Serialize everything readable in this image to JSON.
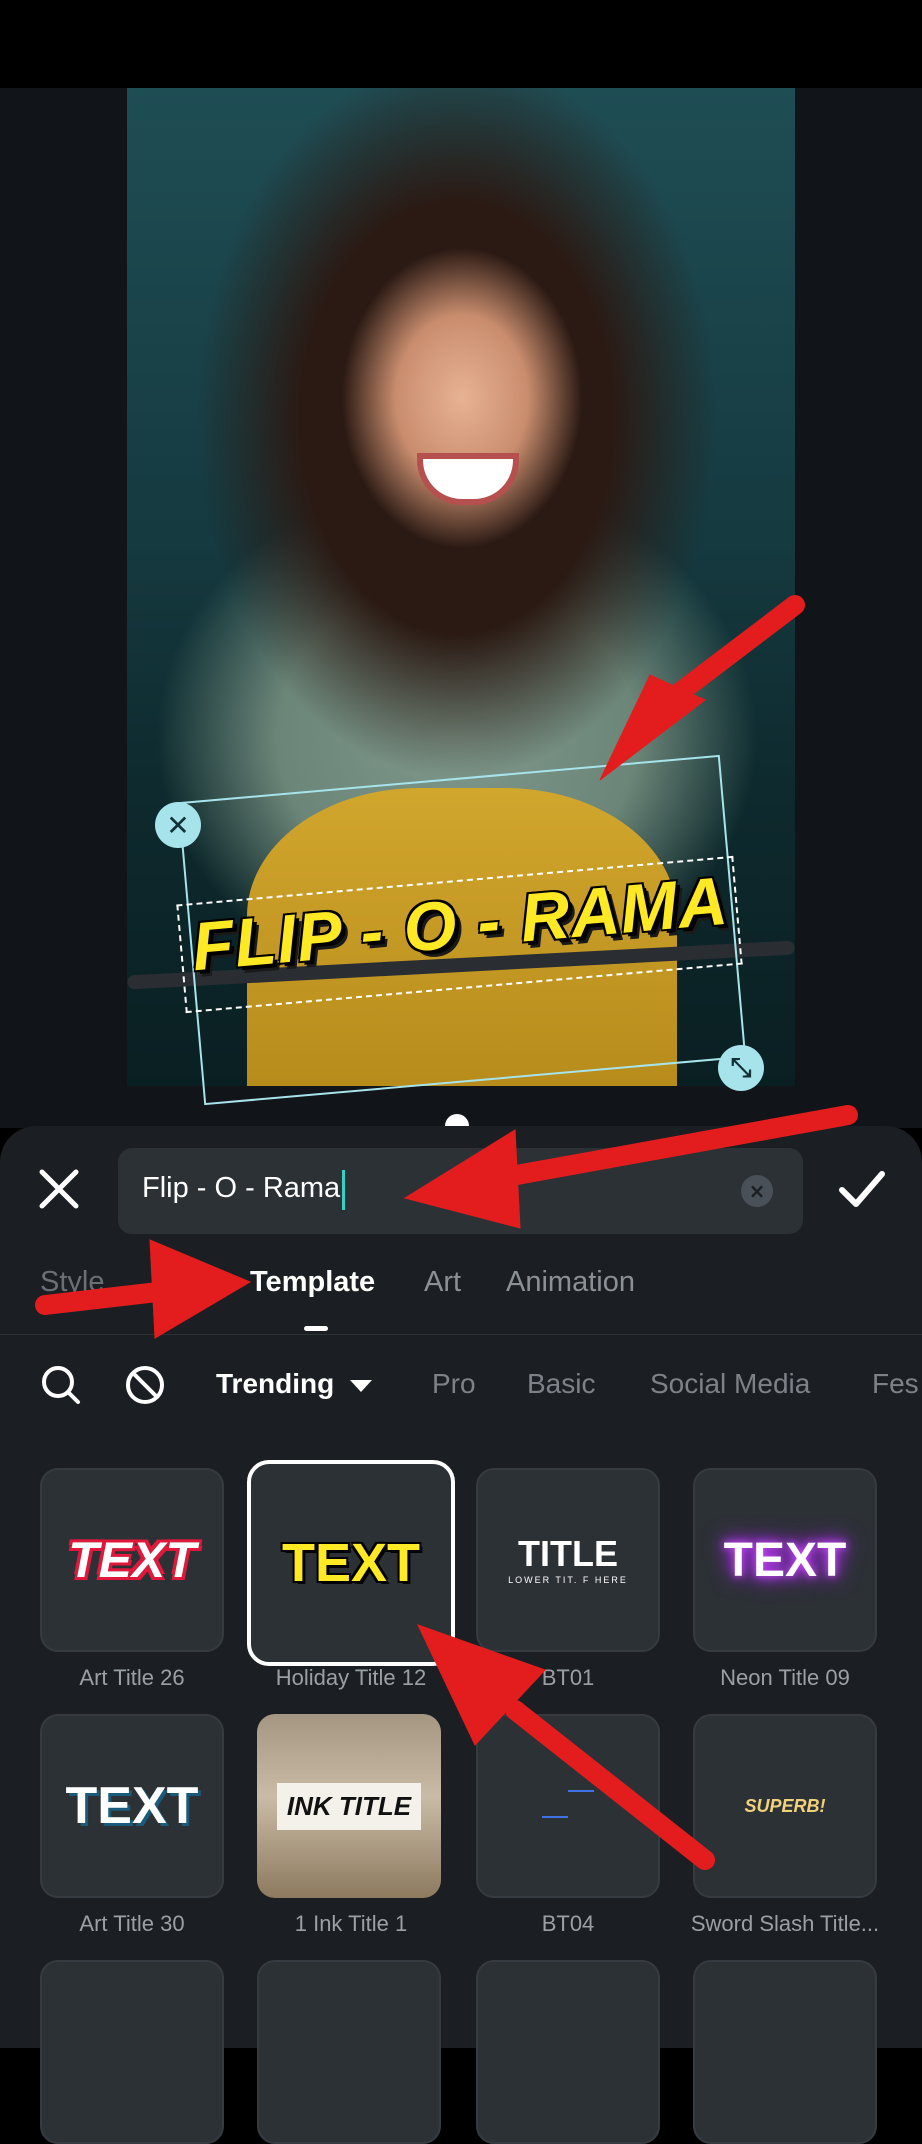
{
  "editor": {
    "overlay_title": "FLIP - O - RAMA",
    "text_input_value": "Flip - O - Rama"
  },
  "tabs": [
    {
      "label": "Style"
    },
    {
      "label": "Template"
    },
    {
      "label": "Art"
    },
    {
      "label": "Animation"
    }
  ],
  "categories": [
    {
      "label": "Trending"
    },
    {
      "label": "Pro"
    },
    {
      "label": "Basic"
    },
    {
      "label": "Social Media"
    },
    {
      "label": "Fes"
    }
  ],
  "templates": [
    {
      "preview": "TEXT",
      "label": "Art Title 26"
    },
    {
      "preview": "TEXT",
      "label": "Holiday Title 12"
    },
    {
      "preview": "TITLE",
      "sub": "LOWER TIT. F HERE",
      "label": "BT01"
    },
    {
      "preview": "TEXT",
      "label": "Neon Title 09"
    },
    {
      "preview": "TEXT",
      "label": "Art Title 30"
    },
    {
      "preview": "INK TITLE",
      "label": "1 Ink Title 1"
    },
    {
      "preview": "",
      "label": "BT04"
    },
    {
      "preview": "SUPERB!",
      "label": "Sword Slash Title..."
    }
  ],
  "colors": {
    "accent_handle": "#a6e3ea",
    "title_yellow": "#ffe924",
    "annotation_arrow": "#e31d1d",
    "caret": "#35d1c6"
  },
  "icons": [
    "close-icon",
    "scale-icon",
    "clear-icon",
    "checkmark-icon",
    "search-icon",
    "no-effect-icon",
    "caret-down-icon"
  ]
}
